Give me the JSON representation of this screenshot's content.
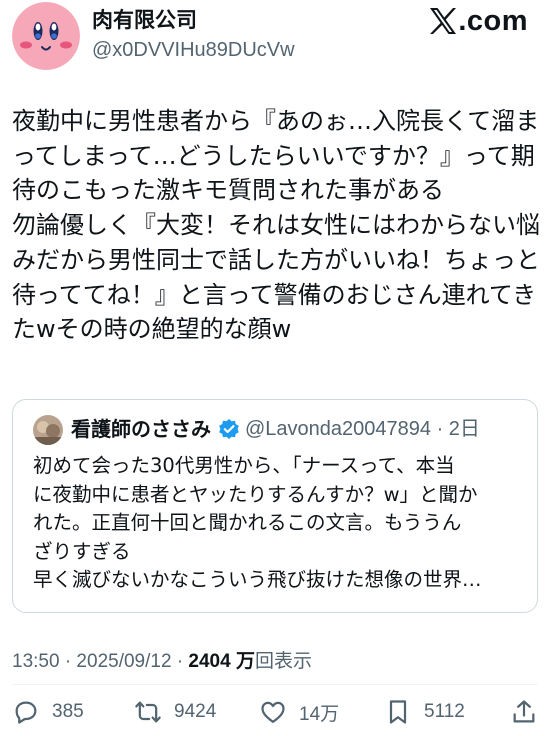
{
  "author": {
    "display_name": "肉有限公司",
    "handle": "@x0DVVIHu89DUcVw",
    "avatar_icon": "kirby-face-avatar"
  },
  "brand": {
    "logo_text": ".com",
    "logo_icon": "x-logo-icon"
  },
  "tweet": {
    "lines": [
      "夜勤中に男性患者から『あのぉ…入院長くて溜ま",
      "ってしまって…どうしたらいいですか？』って期",
      "待のこもった激キモ質問された事がある",
      "勿論優しく『大変！それは女性にはわからない悩",
      "みだから男性同士で話した方がいいね！ちょっと",
      "待っててね！』と言って警備のおじさん連れてき",
      "たwその時の絶望的な顔w"
    ]
  },
  "quoted_tweet": {
    "display_name": "看護師のささみ",
    "verified_icon": "verified-badge-icon",
    "handle_time": "@Lavonda20047894 · 2日",
    "lines": [
      "初めて会った30代男性から、「ナースって、本当",
      "に夜勤中に患者とヤッたりするんすか？w」と聞か",
      "れた。正直何十回と聞かれるこの文言。もううん",
      "ざりすぎる",
      "早く滅びないかなこういう飛び抜けた想像の世界…"
    ]
  },
  "meta": {
    "timestamp": "13:50 · 2025/09/12 · ",
    "views_count": "2404 万",
    "views_label": "回表示"
  },
  "actions": {
    "reply": {
      "icon": "reply-icon",
      "count": "385"
    },
    "repost": {
      "icon": "repost-icon",
      "count": "9424"
    },
    "like": {
      "icon": "heart-icon",
      "count": "14万"
    },
    "bookmark": {
      "icon": "bookmark-icon",
      "count": "5112"
    },
    "share": {
      "icon": "share-icon"
    }
  },
  "colors": {
    "text": "#0f1419",
    "secondary": "#536471",
    "border": "#cfd9de",
    "verified": "#1d9bf0",
    "avatar_pink": "#f7a8b8"
  }
}
